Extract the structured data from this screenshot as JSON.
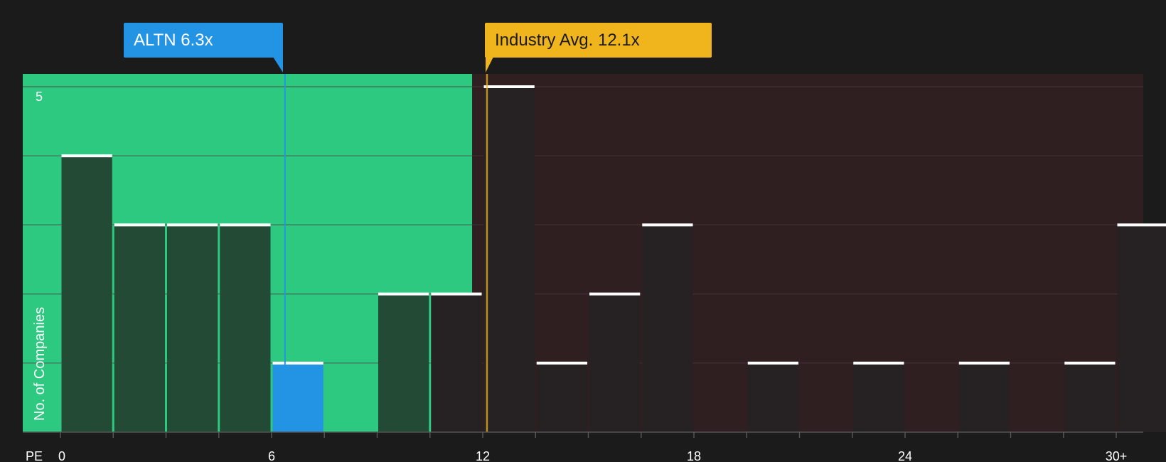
{
  "chart_data": {
    "type": "bar",
    "x_axis_label": "PE",
    "ylabel": "No. of Companies",
    "ylim": [
      0,
      5
    ],
    "y_ticks": [
      5
    ],
    "x_tick_labels": [
      {
        "value": 0,
        "label": "0"
      },
      {
        "value": 6,
        "label": "6"
      },
      {
        "value": 12,
        "label": "12"
      },
      {
        "value": 18,
        "label": "18"
      },
      {
        "value": 24,
        "label": "24"
      },
      {
        "value": 30,
        "label": "30+"
      }
    ],
    "bin_width": 1.5,
    "bins": [
      {
        "start": 0.0,
        "count": 4
      },
      {
        "start": 1.5,
        "count": 3
      },
      {
        "start": 3.0,
        "count": 3
      },
      {
        "start": 4.5,
        "count": 3
      },
      {
        "start": 6.0,
        "count": 1,
        "highlight": true
      },
      {
        "start": 9.0,
        "count": 2
      },
      {
        "start": 10.5,
        "count": 2
      },
      {
        "start": 12.0,
        "count": 5
      },
      {
        "start": 13.5,
        "count": 1
      },
      {
        "start": 15.0,
        "count": 2
      },
      {
        "start": 16.5,
        "count": 3
      },
      {
        "start": 19.5,
        "count": 1
      },
      {
        "start": 22.5,
        "count": 1
      },
      {
        "start": 25.5,
        "count": 1
      },
      {
        "start": 28.5,
        "count": 1
      },
      {
        "start": 30.0,
        "count": 3
      }
    ],
    "zones": {
      "undervalued_end": 11.7,
      "colors": {
        "left": "#2ec980",
        "right": "#2f1f20"
      }
    },
    "markers": [
      {
        "name": "ALTN",
        "value": 6.3,
        "label": "ALTN 6.3x",
        "color": "#2394e3"
      },
      {
        "name": "Industry Avg.",
        "value": 12.1,
        "label": "Industry Avg. 12.1x",
        "color": "#f0b41c"
      }
    ],
    "colors": {
      "bar_left": "#234a35",
      "bar_right": "#262122",
      "bar_highlight": "#2394e3",
      "cap": "#ffffff",
      "grid": "#4a3d3e"
    }
  }
}
